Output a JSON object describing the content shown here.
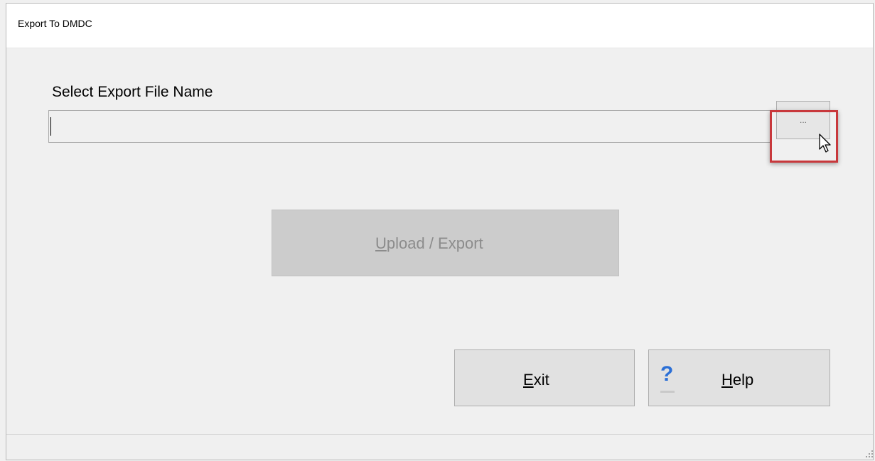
{
  "window": {
    "title": "Export To DMDC"
  },
  "form": {
    "label": "Select Export File Name",
    "file_value": "",
    "browse_label": "...",
    "highlight_color": "#c8383c"
  },
  "actions": {
    "upload_export": {
      "access_key": "U",
      "rest": "pload / Export",
      "enabled": false
    },
    "exit": {
      "access_key": "E",
      "rest": "xit"
    },
    "help": {
      "access_key": "H",
      "rest": "elp",
      "icon": "question-mark-icon",
      "icon_glyph": "?",
      "icon_color": "#2b6fd6"
    }
  }
}
